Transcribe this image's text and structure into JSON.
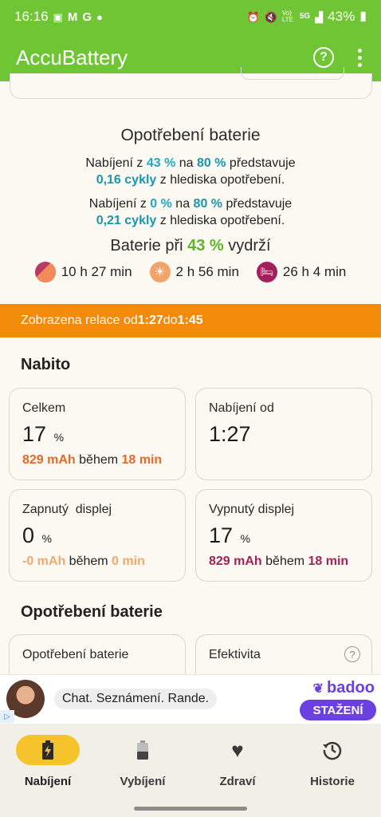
{
  "status_bar": {
    "time": "16:16",
    "left_icons": [
      "image-icon",
      "gmail-icon",
      "google-icon",
      "dot-icon"
    ],
    "right_icons": [
      "alarm-icon",
      "mute-icon",
      "volte-icon",
      "5g-icon",
      "signal-icon"
    ],
    "battery": "43%",
    "text_5g": "5G",
    "text_volte": "Vo) LTE"
  },
  "app_bar": {
    "title": "AccuBattery"
  },
  "wear": {
    "title": "Opotřebení baterie",
    "line1_pre": "Nabíjení z ",
    "line1_from": "43 %",
    "line1_mid": " na ",
    "line1_to": "80 %",
    "line1_post": " představuje",
    "line2_cycles": "0,16 cykly",
    "line2_post": " z hlediska opotřebení.",
    "line3_pre": "Nabíjení z ",
    "line3_from": "0 %",
    "line3_mid": " na ",
    "line3_to": "80 %",
    "line3_post": " představuje",
    "line4_cycles": "0,21 cykly",
    "line4_post": " z hlediska opotřebení.",
    "lasts_pre": "Baterie při ",
    "lasts_pct": "43 %",
    "lasts_post": " vydrží",
    "screen_on": "10 h 27 min",
    "sun": "2 h 56 min",
    "sleep": "26 h 4 min"
  },
  "banner": {
    "pre": "Zobrazena relace od ",
    "from": "1:27",
    "mid": " do ",
    "to": "1:45"
  },
  "charged": {
    "title": "Nabito",
    "total": {
      "label": "Celkem",
      "value": "17",
      "unit": "%",
      "mah": "829 mAh",
      "during": " během ",
      "time": "18 min"
    },
    "charge_from": {
      "label": "Nabíjení od",
      "value": "1:27"
    },
    "screen_on": {
      "label": "Zapnutý  displej",
      "value": "0",
      "unit": "%",
      "mah": "-0 mAh",
      "during": " během ",
      "time": "0 min"
    },
    "screen_off": {
      "label": "Vypnutý displej",
      "value": "17",
      "unit": "%",
      "mah": "829 mAh",
      "during": " během ",
      "time": "18 min"
    }
  },
  "wear_section": {
    "title": "Opotřebení baterie",
    "card_wear": "Opotřebení baterie",
    "card_efficiency": "Efektivita",
    "help": "?"
  },
  "ad": {
    "text": "Chat. Seznámení. Rande.",
    "brand": "badoo",
    "button": "STAŽENÍ",
    "tag": "▷"
  },
  "nav": {
    "items": [
      {
        "label": "Nabíjení",
        "icon": "battery-charging-icon"
      },
      {
        "label": "Vybíjení",
        "icon": "battery-icon"
      },
      {
        "label": "Zdraví",
        "icon": "heart-icon"
      },
      {
        "label": "Historie",
        "icon": "history-icon"
      }
    ],
    "active": 0
  },
  "colors": {
    "brand_green": "#6fc533",
    "banner_orange": "#f48a0a",
    "teal": "#1ea9c2",
    "charge_orange": "#e36a2d",
    "plum": "#a2235c",
    "active_pill": "#f5c32c"
  }
}
